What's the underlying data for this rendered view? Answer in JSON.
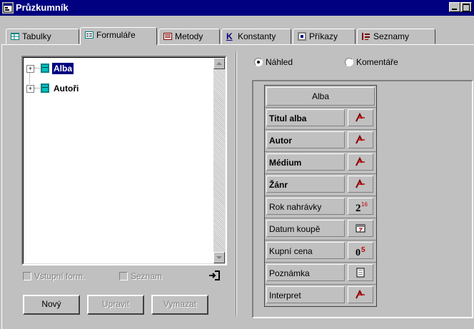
{
  "window": {
    "title": "Průzkumník"
  },
  "tabs": [
    {
      "label": "Tabulky",
      "icon": "table-icon",
      "active": false
    },
    {
      "label": "Formuláře",
      "icon": "form-icon",
      "active": true
    },
    {
      "label": "Metody",
      "icon": "method-icon",
      "active": false
    },
    {
      "label": "Konstanty",
      "icon": "constant-icon",
      "active": false
    },
    {
      "label": "Příkazy",
      "icon": "command-icon",
      "active": false
    },
    {
      "label": "Seznamy",
      "icon": "list-icon",
      "active": false
    }
  ],
  "tree": {
    "items": [
      {
        "label": "Alba",
        "selected": true
      },
      {
        "label": "Autoři",
        "selected": false
      }
    ]
  },
  "options": {
    "input_form": "Vstupní form.",
    "list": "Seznam"
  },
  "buttons": {
    "new": "Nový",
    "edit": "Upravit",
    "delete": "Vymazat"
  },
  "view": {
    "preview": "Náhled",
    "comments": "Komentáře",
    "selected": "preview"
  },
  "form_preview": {
    "title": "Alba",
    "fields": [
      {
        "label": "Titul alba",
        "bold": true,
        "type_icon": "text-field-icon"
      },
      {
        "label": "Autor",
        "bold": true,
        "type_icon": "text-field-icon"
      },
      {
        "label": "Médium",
        "bold": true,
        "type_icon": "text-field-icon"
      },
      {
        "label": "Žánr",
        "bold": true,
        "type_icon": "text-field-icon"
      },
      {
        "label": "Rok nahrávky",
        "bold": false,
        "type_icon": "integer-field-icon"
      },
      {
        "label": "Datum koupě",
        "bold": false,
        "type_icon": "date-field-icon"
      },
      {
        "label": "Kupní cena",
        "bold": false,
        "type_icon": "real-field-icon"
      },
      {
        "label": "Poznámka",
        "bold": false,
        "type_icon": "memo-field-icon"
      },
      {
        "label": "Interpret",
        "bold": false,
        "type_icon": "text-field-icon"
      }
    ]
  }
}
